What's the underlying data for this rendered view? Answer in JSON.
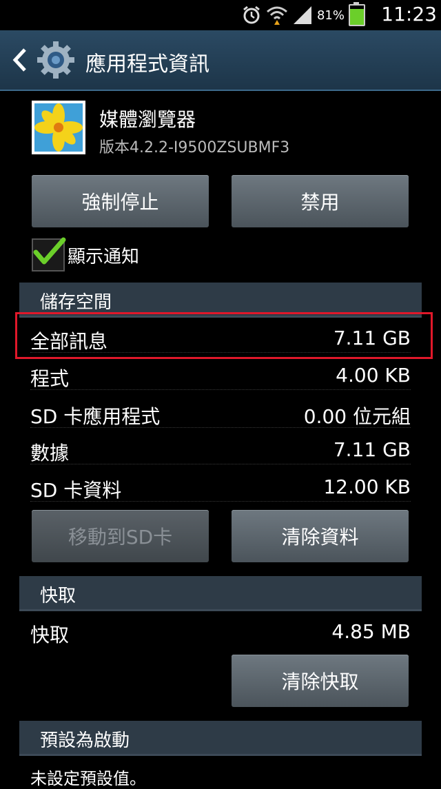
{
  "status_bar": {
    "battery_percent": "81%",
    "time": "11:23",
    "battery_level": 0.81,
    "icons": [
      "alarm-icon",
      "wifi-icon",
      "signal-icon",
      "battery-icon"
    ]
  },
  "action_bar": {
    "title": "應用程式資訊",
    "icons": [
      "back-icon",
      "settings-gear-icon"
    ]
  },
  "app": {
    "name": "媒體瀏覽器",
    "version": "版本4.2.2-I9500ZSUBMF3",
    "icon": "lily-flower-icon"
  },
  "buttons": {
    "force_stop": "強制停止",
    "disable": "禁用",
    "move_to_sd": "移動到SD卡",
    "clear_data": "清除資料",
    "clear_cache": "清除快取"
  },
  "notifications": {
    "label": "顯示通知",
    "checked": true
  },
  "storage": {
    "header": "儲存空間",
    "rows": [
      {
        "label": "全部訊息",
        "value": "7.11 GB"
      },
      {
        "label": "程式",
        "value": "4.00 KB"
      },
      {
        "label": "SD 卡應用程式",
        "value": "0.00 位元組"
      },
      {
        "label": "數據",
        "value": "7.11 GB"
      },
      {
        "label": "SD 卡資料",
        "value": "12.00 KB"
      }
    ]
  },
  "cache": {
    "header": "快取",
    "label": "快取",
    "value": "4.85 MB"
  },
  "launch_default": {
    "header": "預設為啟動",
    "text": "未設定預設值。"
  },
  "colors": {
    "highlight": "#e0182a",
    "check": "#6bcf2a"
  }
}
